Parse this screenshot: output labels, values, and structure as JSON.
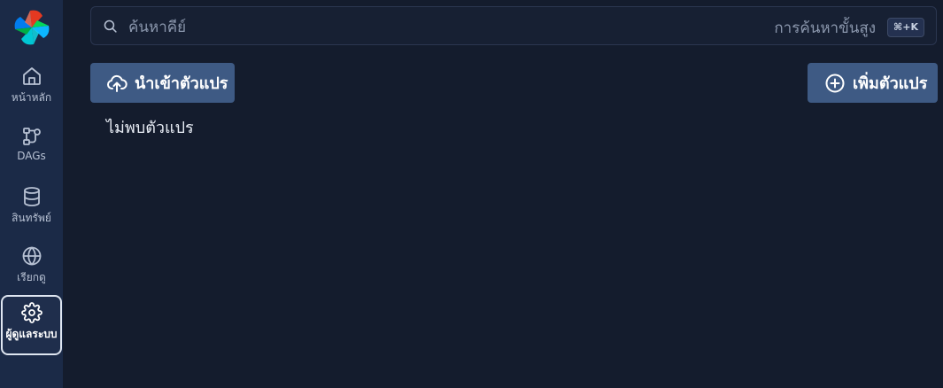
{
  "sidebar": {
    "logo": "airflow-pinwheel-logo",
    "items": [
      {
        "label": "หน้าหลัก",
        "icon": "home-icon"
      },
      {
        "label": "DAGs",
        "icon": "dag-flow-icon"
      },
      {
        "label": "สินทรัพย์",
        "icon": "database-icon"
      },
      {
        "label": "เรียกดู",
        "icon": "globe-icon"
      },
      {
        "label": "ผู้ดูแลระบบ",
        "icon": "gear-icon",
        "active": true
      }
    ]
  },
  "search": {
    "placeholder": "ค้นหาคีย์",
    "advanced_label": "การค้นหาขั้นสูง",
    "shortcut": "⌘+K"
  },
  "toolbar": {
    "import_label": "นำเข้าตัวแปร",
    "add_label": "เพิ่มตัวแปร"
  },
  "main": {
    "empty_message": "ไม่พบตัวแปร"
  },
  "colors": {
    "background": "#141c2d",
    "sidebar": "#1b2a47",
    "button": "#3e5a84"
  }
}
